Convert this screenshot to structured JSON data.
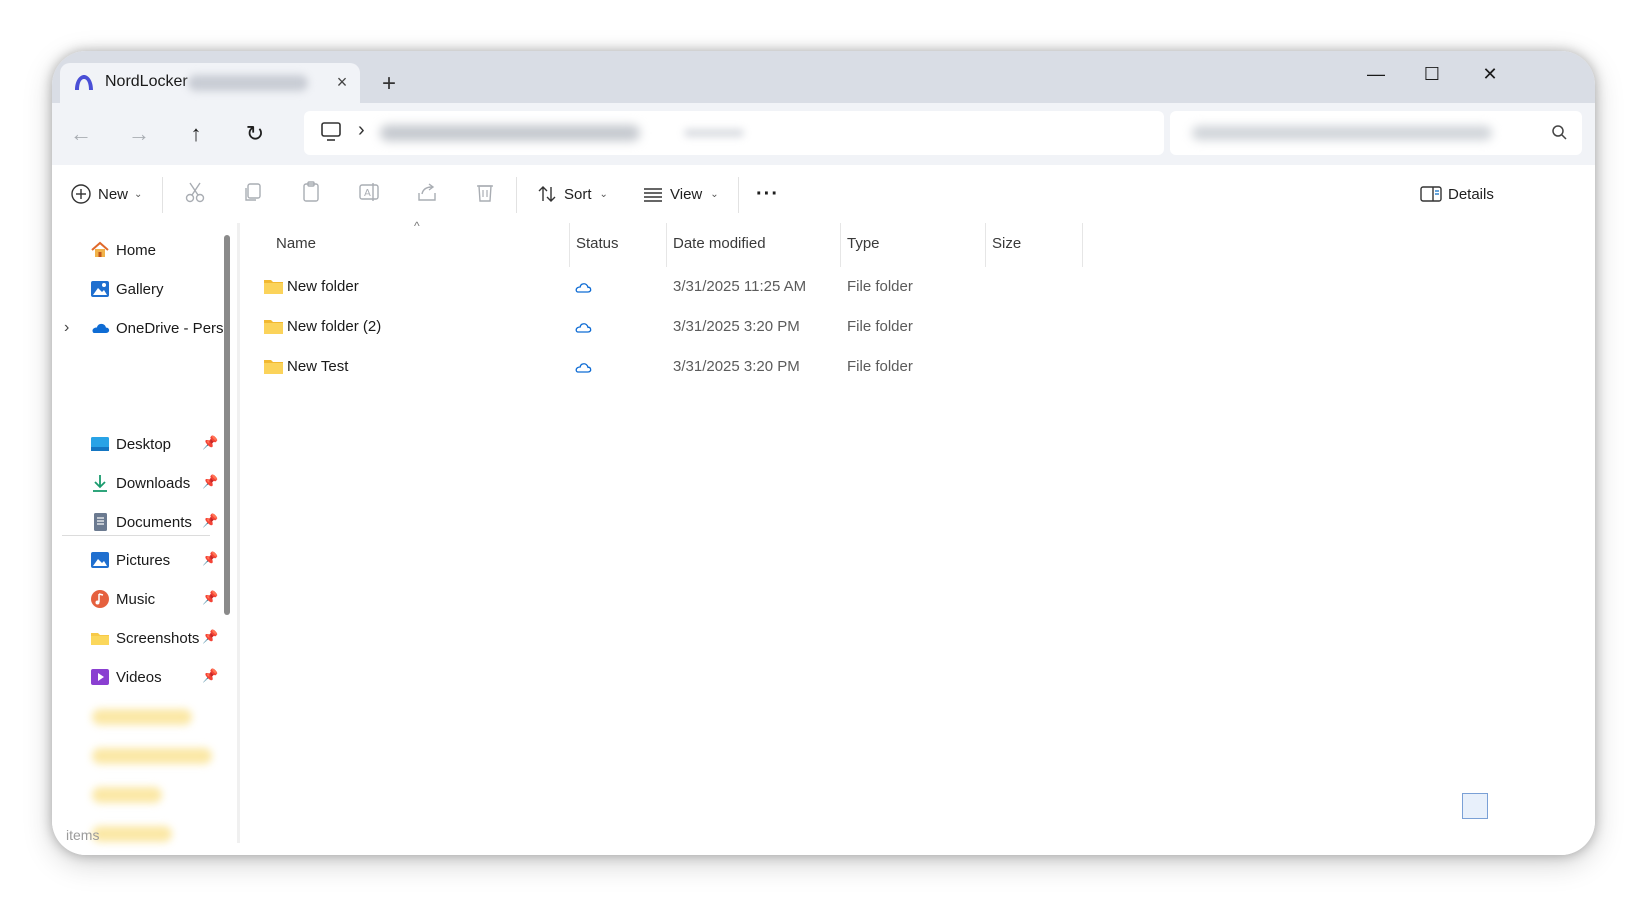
{
  "tab": {
    "title": "NordLocker",
    "close": "×",
    "new": "+"
  },
  "window_controls": {
    "minimize": "—",
    "maximize": "☐",
    "close": "✕"
  },
  "nav": {
    "back": "←",
    "forward": "→",
    "up": "↑",
    "refresh": "↻",
    "chevron": "›"
  },
  "toolbar": {
    "new_label": "New",
    "sort_label": "Sort",
    "view_label": "View",
    "more_label": "···",
    "details_label": "Details"
  },
  "sidebar": {
    "top_items": [
      {
        "label": "Home"
      },
      {
        "label": "Gallery"
      },
      {
        "label": "OneDrive - Personal"
      }
    ],
    "pinned_items": [
      {
        "label": "Desktop"
      },
      {
        "label": "Downloads"
      },
      {
        "label": "Documents"
      },
      {
        "label": "Pictures"
      },
      {
        "label": "Music"
      },
      {
        "label": "Screenshots"
      },
      {
        "label": "Videos"
      }
    ],
    "expand_chevron": "›"
  },
  "columns": {
    "name": "Name",
    "status": "Status",
    "date": "Date modified",
    "type": "Type",
    "size": "Size"
  },
  "files": [
    {
      "name": "New folder",
      "date": "3/31/2025 11:25 AM",
      "type": "File folder"
    },
    {
      "name": "New folder (2)",
      "date": "3/31/2025 3:20 PM",
      "type": "File folder"
    },
    {
      "name": "New Test",
      "date": "3/31/2025 3:20 PM",
      "type": "File folder"
    }
  ],
  "status_bar": {
    "items_label": "items"
  },
  "colors": {
    "folder": "#f7c948",
    "accent": "#0067c0",
    "tabbar": "#d9dde5"
  }
}
